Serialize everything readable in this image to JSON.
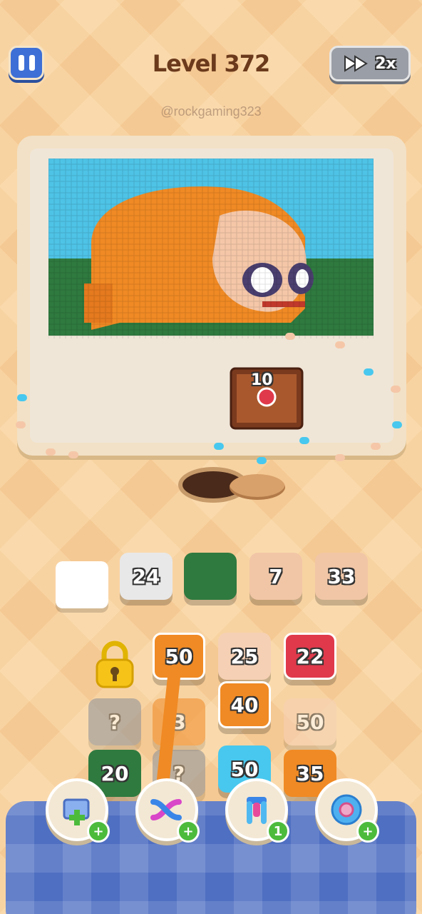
{
  "header": {
    "title": "Level 372",
    "speed_label": "2x"
  },
  "watermark": "@rockgaming323",
  "board": {
    "chest_count": "10"
  },
  "targets": [
    {
      "label": "",
      "color": "#ffffff"
    },
    {
      "label": "24",
      "color": "#e8e8e8"
    },
    {
      "label": "",
      "color": "#2f7a3f"
    },
    {
      "label": "7",
      "color": "#f1c6a6"
    },
    {
      "label": "33",
      "color": "#f1c6a6"
    }
  ],
  "grid": {
    "lock_icon": "padlock-icon",
    "tiles": [
      {
        "label": "50",
        "color": "#f08a24"
      },
      {
        "label": "25",
        "color": "#f6d0b4"
      },
      {
        "label": "22",
        "color": "#e0394b"
      },
      {
        "label": "?",
        "color": "#8b8f98"
      },
      {
        "label": "3",
        "color": "#f08a24"
      },
      {
        "label": "40",
        "color": "#f08a24"
      },
      {
        "label": "50",
        "color": "#f6d0b4"
      },
      {
        "label": "20",
        "color": "#2f7a3f"
      },
      {
        "label": "?",
        "color": "#8b8f98"
      },
      {
        "label": "50",
        "color": "#48c8ee"
      },
      {
        "label": "35",
        "color": "#f08a24"
      }
    ]
  },
  "boosters": [
    {
      "icon": "add-slot-icon",
      "badge": "+"
    },
    {
      "icon": "shuffle-icon",
      "badge": "+"
    },
    {
      "icon": "magnet-icon",
      "badge": "1"
    },
    {
      "icon": "spool-icon",
      "badge": "+"
    }
  ]
}
